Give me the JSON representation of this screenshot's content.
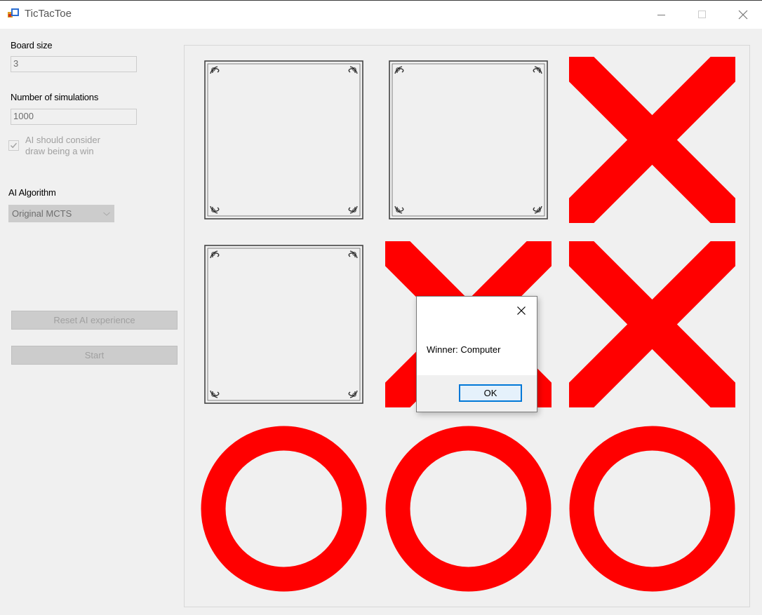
{
  "window": {
    "title": "TicTacToe"
  },
  "settings": {
    "board_size_label": "Board size",
    "board_size_value": "3",
    "simulations_label": "Number of simulations",
    "simulations_value": "1000",
    "draw_as_win_label_line1": "AI should consider",
    "draw_as_win_label_line2": "draw being a win",
    "draw_as_win_checked": true,
    "algorithm_label": "AI Algorithm",
    "algorithm_selected": "Original MCTS",
    "reset_button_label": "Reset AI experience",
    "start_button_label": "Start"
  },
  "board": {
    "size": 3,
    "cells": [
      [
        "empty",
        "empty",
        "X"
      ],
      [
        "empty",
        "X",
        "X"
      ],
      [
        "O",
        "O",
        "O"
      ]
    ],
    "mark_color": "#ff0000"
  },
  "dialog": {
    "message": "Winner: Computer",
    "ok_label": "OK"
  },
  "colors": {
    "accent": "#0078d7",
    "window_bg": "#f0f0f0"
  }
}
